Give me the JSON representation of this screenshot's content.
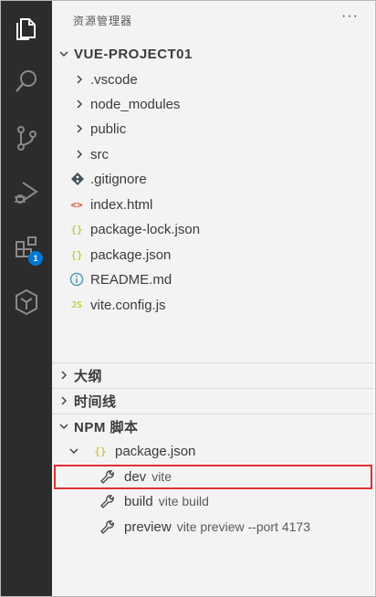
{
  "sidebar": {
    "title": "资源管理器",
    "more_label": "···"
  },
  "activity_bar": {
    "items": [
      {
        "name": "explorer-icon",
        "active": true
      },
      {
        "name": "search-icon"
      },
      {
        "name": "source-control-icon"
      },
      {
        "name": "run-debug-icon"
      },
      {
        "name": "extensions-icon",
        "badge": "1"
      },
      {
        "name": "remote-icon"
      }
    ]
  },
  "explorer": {
    "project_name": "VUE-PROJECT01",
    "folders": [
      ".vscode",
      "node_modules",
      "public",
      "src"
    ],
    "files": [
      {
        "name": ".gitignore",
        "icon": "git-diamond-icon"
      },
      {
        "name": "index.html",
        "icon": "html-icon"
      },
      {
        "name": "package-lock.json",
        "icon": "json-icon"
      },
      {
        "name": "package.json",
        "icon": "json-icon"
      },
      {
        "name": "README.md",
        "icon": "info-icon"
      },
      {
        "name": "vite.config.js",
        "icon": "js-icon"
      }
    ]
  },
  "sections": {
    "outline": "大纲",
    "timeline": "时间线",
    "npm_scripts": "NPM 脚本"
  },
  "npm": {
    "package_file": "package.json",
    "scripts": [
      {
        "name": "dev",
        "command": "vite",
        "highlighted": true
      },
      {
        "name": "build",
        "command": "vite build"
      },
      {
        "name": "preview",
        "command": "vite preview --port 4173"
      }
    ]
  },
  "colors": {
    "activity_bg": "#2c2c2c",
    "sidebar_bg": "#f3f3f3",
    "badge": "#0078d4",
    "highlight_border": "#e03131",
    "json_icon": "#cbcb41",
    "html_icon": "#e44d26",
    "js_icon": "#cbcb41",
    "info_icon": "#519aba"
  }
}
